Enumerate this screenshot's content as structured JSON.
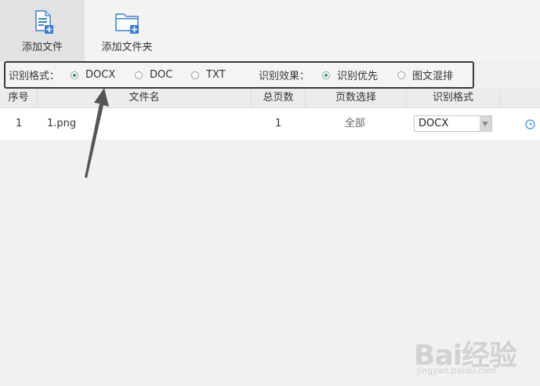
{
  "toolbar": {
    "add_file_label": "添加文件",
    "add_folder_label": "添加文件夹",
    "add_file_icon": "add-file-icon",
    "add_folder_icon": "add-folder-icon"
  },
  "options": {
    "format_label": "识别格式：",
    "format_options": [
      "DOCX",
      "DOC",
      "TXT"
    ],
    "format_selected": "DOCX",
    "effect_label": "识别效果：",
    "effect_options": [
      "识别优先",
      "图文混排"
    ],
    "effect_selected": "识别优先"
  },
  "table": {
    "columns": [
      "序号",
      "文件名",
      "总页数",
      "页数选择",
      "识别格式"
    ],
    "rows": [
      {
        "index": "1",
        "filename": "1.png",
        "pages": "1",
        "page_selection": "全部",
        "format": "DOCX"
      }
    ]
  },
  "watermark": {
    "text": "Bai经验",
    "sub": "jingyan.baidu.com"
  },
  "colors": {
    "radio_selected": "#1fa463",
    "highlight_border": "#3a3a3a",
    "clock_icon": "#3b8fd9"
  }
}
